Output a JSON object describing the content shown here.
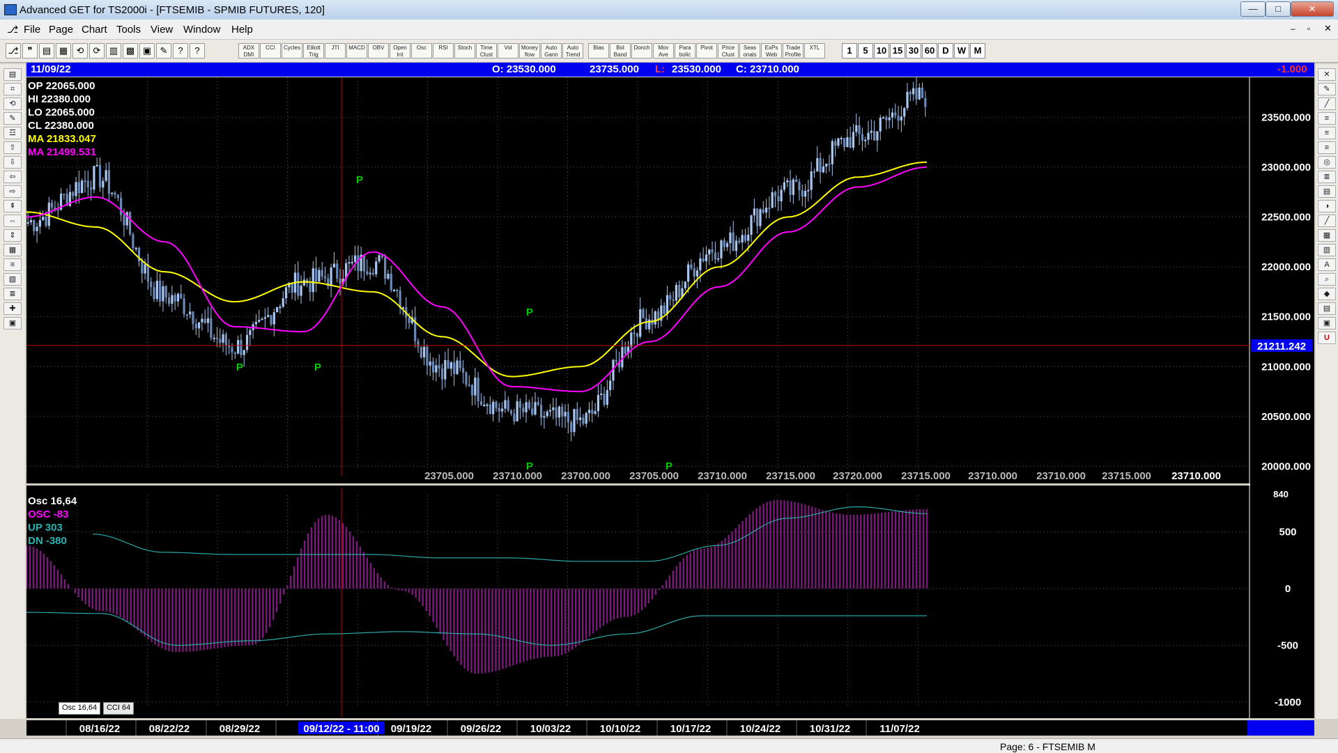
{
  "window": {
    "title": "Advanced GET for TS2000i - [FTSEMIB - SPMIB FUTURES, 120]",
    "controls": [
      "—",
      "□",
      "✕"
    ]
  },
  "menu": [
    "File",
    "Page",
    "Chart",
    "Tools",
    "View",
    "Window",
    "Help"
  ],
  "toolbar": {
    "studies": [
      "ADX DMI",
      "CCI",
      "Cycles",
      "Elliott Trig",
      "JTI",
      "MACD",
      "OBV",
      "Open Int",
      "Osc",
      "RSI",
      "Stoch",
      "Time Clust",
      "Vol",
      "Money flow",
      "Auto Gann",
      "Auto Trend",
      "Bias",
      "Bol Band",
      "Donch",
      "Mov Ave",
      "Para bolic",
      "Pivot",
      "Price Clust",
      "Seas onals",
      "ExPs Web",
      "Trade Profile",
      "XTL"
    ],
    "timeframes": [
      "1",
      "5",
      "10",
      "15",
      "30",
      "60",
      "D",
      "W",
      "M"
    ]
  },
  "infobar": {
    "date": "11/09/22",
    "open": "O: 23530.000",
    "high": "23735.000",
    "low_label": "L:",
    "low": "23530.000",
    "close": "C: 23710.000",
    "change": "-1.000"
  },
  "legend": {
    "op": "OP  22065.000",
    "hi": "HI   22380.000",
    "lo": "LO  22065.000",
    "cl": "CL   22380.000",
    "ma1": "MA  21833.047",
    "ma2": "MA  21499.531"
  },
  "osc_legend": {
    "title": "Osc 16,64",
    "osc": "OSC -83",
    "up": "UP   303",
    "dn": "DN   -380",
    "scale_top": "840"
  },
  "tabs": [
    "Osc 16,64",
    "CCI 64"
  ],
  "colors": {
    "up_candle": "#a9c7f0",
    "ma_fast": "#ffff00",
    "ma_slow": "#ff00ff",
    "pivot": "#00cc00",
    "osc_bar": "#7a1a7a",
    "band": "#2aa8a8",
    "crosshair": "#c00000"
  },
  "crosshair": {
    "price_label": "21211.242",
    "price": 21211.242,
    "date_label": "09/12/22 - 11:00"
  },
  "price_axis": [
    "23500.000",
    "23000.000",
    "22500.000",
    "22000.000",
    "21500.000",
    "21000.000",
    "20500.000",
    "20000.000"
  ],
  "bottom_labels": [
    "23705.000",
    "23710.000",
    "23700.000",
    "23705.000",
    "23710.000",
    "23715.000",
    "23720.000",
    "23715.000",
    "23710.000",
    "23710.000",
    "23715.000",
    "23710.000"
  ],
  "osc_axis": [
    "500",
    "0",
    "-500",
    "-1000"
  ],
  "dates": [
    "08/16/22",
    "08/22/22",
    "08/29/22",
    "09/0",
    "09/19/22",
    "09/26/22",
    "10/03/22",
    "10/10/22",
    "10/17/22",
    "10/24/22",
    "10/31/22",
    "11/07/22"
  ],
  "pivots": [
    "P",
    "P",
    "P",
    "P",
    "P",
    "P"
  ],
  "statusbar": "Page: 6 - FTSEMIB M",
  "chart_data": [
    {
      "type": "line",
      "title": "",
      "ylim": [
        19850,
        23900
      ],
      "x": [
        "08/16/22",
        "08/22/22",
        "08/29/22",
        "09/05/22",
        "09/12/22",
        "09/19/22",
        "09/26/22",
        "10/03/22",
        "10/10/22",
        "10/17/22",
        "10/24/22",
        "10/31/22",
        "11/07/22",
        "11/09/22"
      ],
      "series": [
        {
          "name": "",
          "values": [
            22450,
            22900,
            21700,
            21200,
            21850,
            22050,
            21000,
            20550,
            20450,
            21500,
            22200,
            22750,
            23300,
            23710
          ]
        },
        {
          "name": "",
          "values": [
            22550,
            22400,
            21950,
            21650,
            21850,
            21750,
            21300,
            20900,
            21000,
            21450,
            22000,
            22500,
            22900,
            23050
          ]
        },
        {
          "name": "",
          "values": [
            22500,
            22700,
            22250,
            21400,
            21350,
            22150,
            21600,
            20800,
            20750,
            21250,
            21800,
            22350,
            22800,
            23000
          ]
        }
      ]
    },
    {
      "type": "bar",
      "title": "",
      "ylim": [
        -1050,
        840
      ],
      "x": [
        "08/16/22",
        "08/22/22",
        "08/29/22",
        "09/05/22",
        "09/12/22",
        "09/19/22",
        "09/26/22",
        "10/03/22",
        "10/10/22",
        "10/17/22",
        "10/24/22",
        "10/31/22",
        "11/07/22"
      ],
      "series": [
        {
          "name": "",
          "values": [
            380,
            -200,
            -560,
            -500,
            650,
            -20,
            -750,
            -600,
            -250,
            350,
            780,
            650,
            700
          ]
        },
        {
          "name": "",
          "values": [
            480,
            320,
            300,
            300,
            300,
            270,
            270,
            240,
            240,
            380,
            620,
            720,
            660
          ]
        },
        {
          "name": "",
          "values": [
            -210,
            -220,
            -500,
            -460,
            -400,
            -380,
            -400,
            -500,
            -400,
            -240,
            -240,
            -240,
            -240
          ]
        }
      ]
    }
  ]
}
